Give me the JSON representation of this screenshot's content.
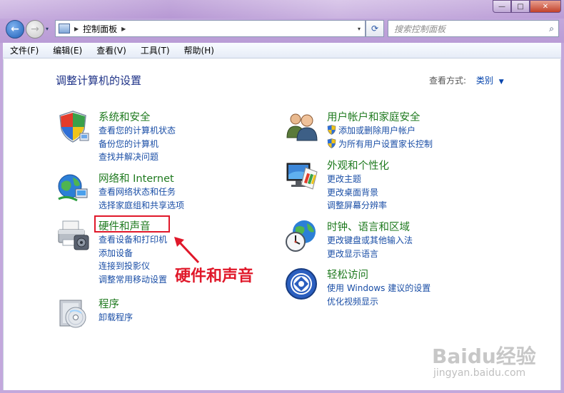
{
  "window": {
    "min_glyph": "—",
    "max_glyph": "□",
    "close_glyph": "✕"
  },
  "nav": {
    "back_glyph": "←",
    "forward_glyph": "→",
    "dropdown_glyph": "▾",
    "address_path": "控制面板",
    "address_sep": "▶",
    "refresh_glyph": "⟳",
    "search_placeholder": "搜索控制面板",
    "search_glyph": "⌕"
  },
  "menu": {
    "items": [
      "文件(F)",
      "编辑(E)",
      "查看(V)",
      "工具(T)",
      "帮助(H)"
    ]
  },
  "page": {
    "title": "调整计算机的设置",
    "view_by_label": "查看方式:",
    "view_by_value": "类别",
    "view_by_caret": "▼"
  },
  "categories_left": [
    {
      "icon": "shield-security-icon",
      "title": "系统和安全",
      "links": [
        "查看您的计算机状态",
        "备份您的计算机",
        "查找并解决问题"
      ]
    },
    {
      "icon": "network-globe-icon",
      "title": "网络和 Internet",
      "links": [
        "查看网络状态和任务",
        "选择家庭组和共享选项"
      ]
    },
    {
      "icon": "printer-hardware-icon",
      "title": "硬件和声音",
      "links": [
        "查看设备和打印机",
        "添加设备",
        "连接到投影仪",
        "调整常用移动设置"
      ]
    },
    {
      "icon": "programs-cd-icon",
      "title": "程序",
      "links": [
        "卸载程序"
      ]
    }
  ],
  "categories_right": [
    {
      "icon": "users-icon",
      "title": "用户帐户和家庭安全",
      "links": [
        "添加或删除用户帐户",
        "为所有用户设置家长控制"
      ]
    },
    {
      "icon": "monitor-appearance-icon",
      "title": "外观和个性化",
      "links": [
        "更改主题",
        "更改桌面背景",
        "调整屏幕分辨率"
      ]
    },
    {
      "icon": "clock-globe-icon",
      "title": "时钟、语言和区域",
      "links": [
        "更改键盘或其他输入法",
        "更改显示语言"
      ]
    },
    {
      "icon": "ease-of-access-icon",
      "title": "轻松访问",
      "links": [
        "使用 Windows 建议的设置",
        "优化视频显示"
      ]
    }
  ],
  "annotation": {
    "text": "硬件和声音",
    "color": "#e0182a"
  },
  "watermark": {
    "main": "Baidu经验",
    "sub": "jingyan.baidu.com"
  }
}
